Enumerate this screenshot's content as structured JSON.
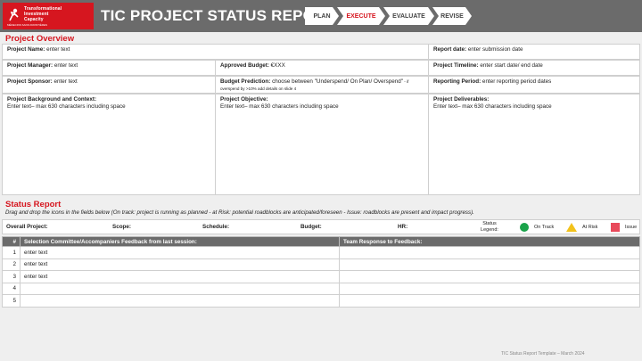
{
  "header": {
    "logo_text": [
      "Transformational",
      "Investment",
      "Capacity"
    ],
    "logo_sub": "MÉDECINS SANS FRONTIÈRES",
    "title": "TIC PROJECT STATUS REPORT",
    "phases": [
      {
        "label": "PLAN",
        "active": false
      },
      {
        "label": "EXECUTE",
        "active": true
      },
      {
        "label": "EVALUATE",
        "active": false
      },
      {
        "label": "REVISE",
        "active": false
      }
    ],
    "accent": "#d6161f",
    "bar_color": "#6b6b6b"
  },
  "overview": {
    "title": "Project Overview",
    "project_name_label": "Project Name:",
    "project_name_value": " enter text",
    "report_date_label": "Report date:",
    "report_date_value": " enter submission date",
    "manager_label": "Project Manager:",
    "manager_value": " enter text",
    "budget_label": "Approved Budget:",
    "budget_value": " €XXX",
    "timeline_label": "Project Timeline:",
    "timeline_value": " enter start date/ end date",
    "sponsor_label": "Project Sponsor:",
    "sponsor_value": " enter text",
    "prediction_label": "Budget Prediction:",
    "prediction_value": " choose between \"Underspend/ On Plan/ Overspend\"",
    "prediction_note": " - if overspend by >10% add details on slide 4",
    "period_label": "Reporting Period:",
    "period_value": " enter reporting period dates",
    "background_label": "Project Background and Context:",
    "background_value": "Enter text– max 630 characters including space",
    "objective_label": "Project Objective:",
    "objective_value": "Enter text– max 630 characters including space",
    "deliverables_label": "Project Deliverables:",
    "deliverables_value": "Enter text– max 630 characters including space"
  },
  "status": {
    "title": "Status Report",
    "subtitle": "Drag and drop the icons in the fields below (On track: project is running as planned - at Risk: potential roadblocks are anticipated/foreseen - Issue: roadblocks are present and impact progress).",
    "fields": [
      "Overall Project:",
      "Scope:",
      "Schedule:",
      "Budget:",
      "HR:"
    ],
    "legend_label": "Status Legend:",
    "legend": [
      {
        "label": "On Track",
        "icon": "green-circle-icon",
        "color": "#1aa34a"
      },
      {
        "label": "At Risk",
        "icon": "yellow-triangle-icon",
        "color": "#f2c21b"
      },
      {
        "label": "Issue",
        "icon": "red-square-icon",
        "color": "#e8495a"
      }
    ]
  },
  "feedback_table": {
    "headers": [
      "#",
      "Selection Committee/Accompaniers Feedback from last session:",
      "Team Response to Feedback:"
    ],
    "rows": [
      {
        "num": "1",
        "feedback": "enter text",
        "response": ""
      },
      {
        "num": "2",
        "feedback": "enter text",
        "response": ""
      },
      {
        "num": "3",
        "feedback": "enter text",
        "response": ""
      },
      {
        "num": "4",
        "feedback": "",
        "response": ""
      },
      {
        "num": "5",
        "feedback": "",
        "response": ""
      }
    ]
  },
  "footer": "TIC Status Report Template – March 2024"
}
